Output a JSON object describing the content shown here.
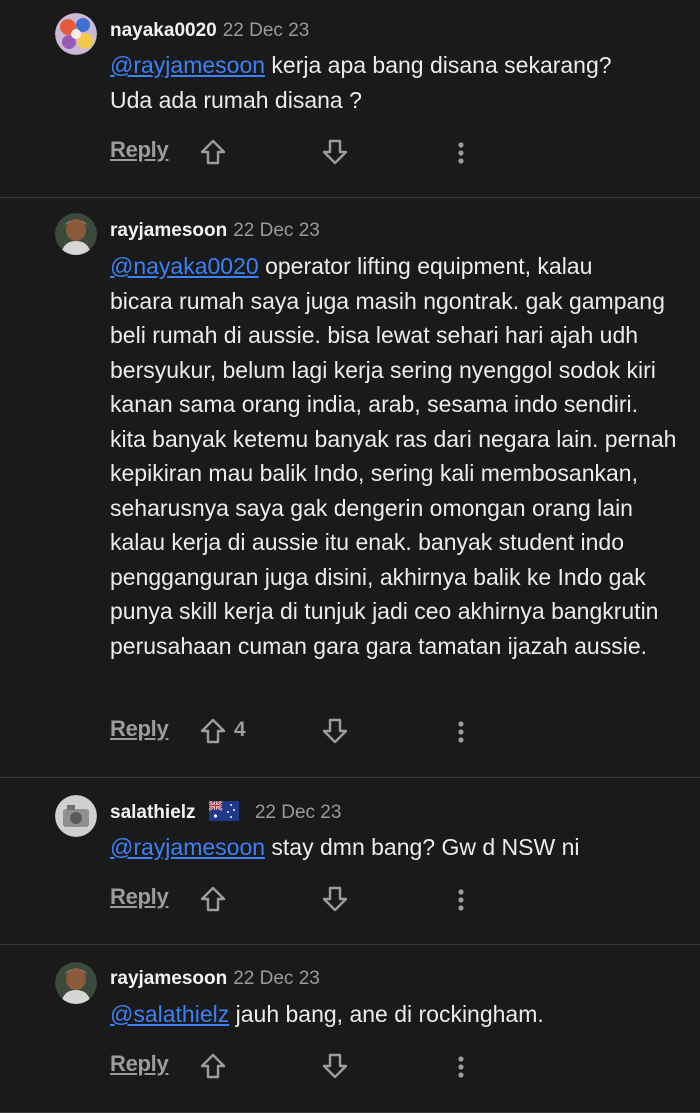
{
  "comments": [
    {
      "username": "nayaka0020",
      "date": "22 Dec 23",
      "mention": "@rayjamesoon",
      "text_first": " kerja apa bang disana sekarang?",
      "text_rest": "Uda ada rumah disana ?",
      "reply_label": "Reply",
      "upvotes": ""
    },
    {
      "username": "rayjamesoon",
      "date": "22 Dec 23",
      "mention": "@nayaka0020",
      "text_first": " operator lifting equipment, kalau",
      "text_rest": "bicara rumah saya juga masih ngontrak. gak gampang beli rumah di aussie. bisa lewat sehari hari ajah udh bersyukur, belum lagi kerja sering nyenggol sodok kiri kanan sama orang india, arab, sesama indo sendiri. kita banyak ketemu banyak ras dari negara lain. pernah kepikiran mau balik Indo, sering kali membosankan, seharusnya saya gak dengerin omongan orang lain kalau kerja di aussie itu enak. banyak student indo pengganguran juga disini, akhirnya balik ke Indo gak punya skill kerja di tunjuk jadi ceo akhirnya bangkrutin perusahaan cuman gara gara tamatan ijazah aussie.",
      "reply_label": "Reply",
      "upvotes": "4"
    },
    {
      "username": "salathielz",
      "date": "22 Dec 23",
      "flag": "australia-flag",
      "mention": "@rayjamesoon",
      "text_first": " stay dmn bang? Gw d NSW ni",
      "text_rest": "",
      "reply_label": "Reply",
      "upvotes": ""
    },
    {
      "username": "rayjamesoon",
      "date": "22 Dec 23",
      "mention": "@salathielz",
      "text_first": " jauh bang, ane di rockingham.",
      "text_rest": "",
      "reply_label": "Reply",
      "upvotes": ""
    }
  ],
  "colors": {
    "background": "#1a1a1a",
    "mention": "#3b82f6",
    "muted": "#9c9c9c",
    "divider": "#3a3a3a"
  },
  "icons": [
    "upvote-arrow-icon",
    "downvote-arrow-icon",
    "more-options-icon",
    "australia-flag"
  ]
}
